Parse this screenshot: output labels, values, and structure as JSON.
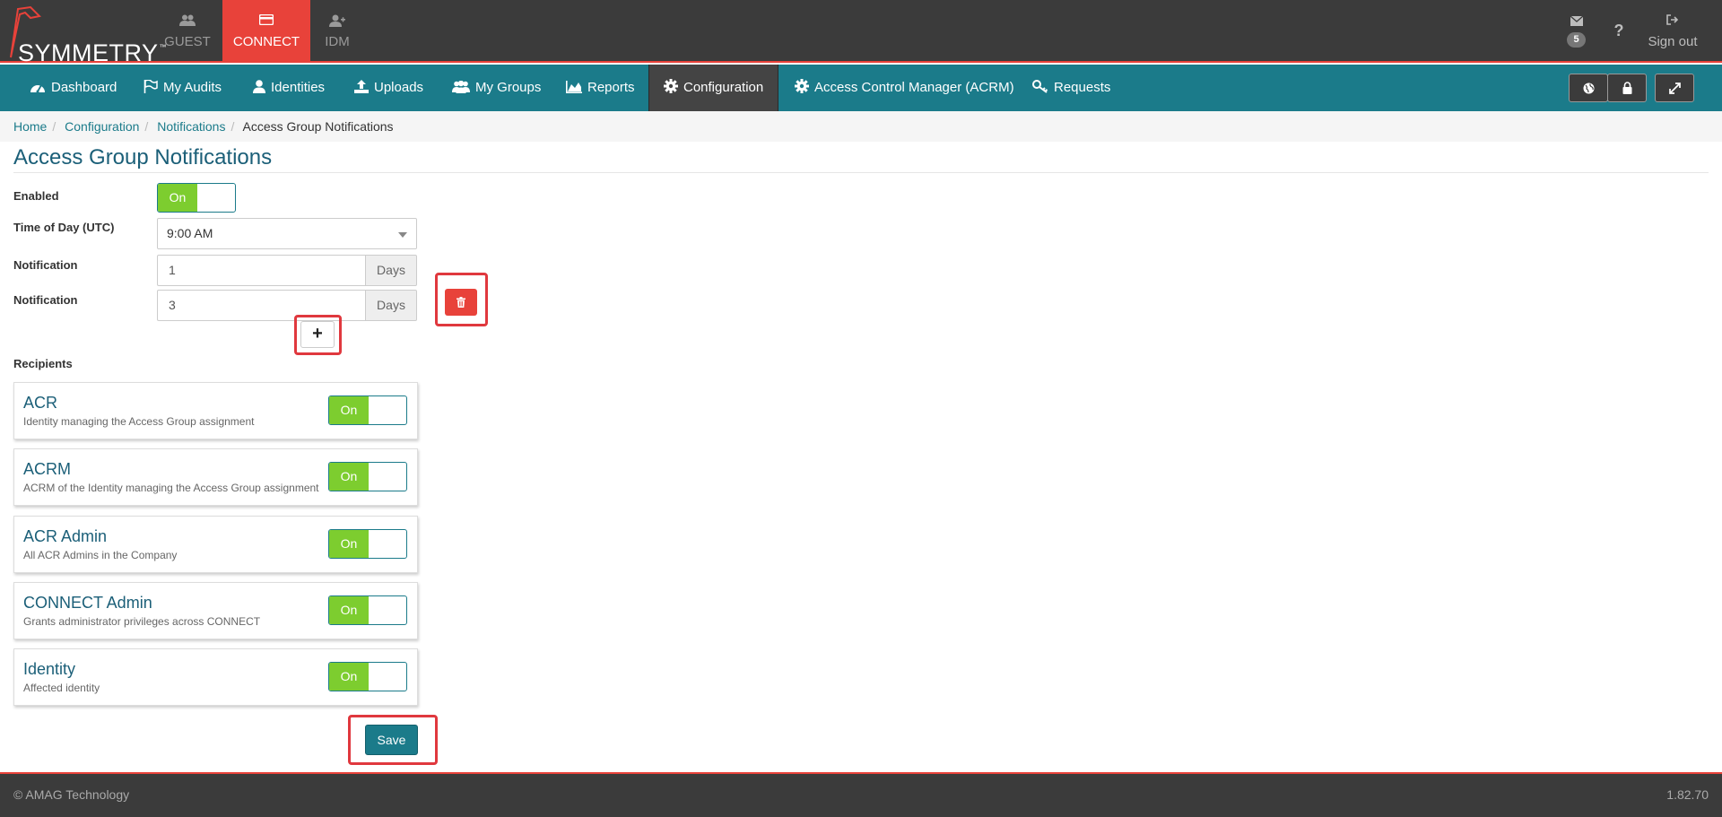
{
  "brand": {
    "logo_text": "SYMMETRY",
    "trademark": "™"
  },
  "app_tabs": [
    {
      "label": "GUEST",
      "icon": "users-icon"
    },
    {
      "label": "CONNECT",
      "icon": "card-icon",
      "active": true
    },
    {
      "label": "IDM",
      "icon": "user-plus-icon"
    }
  ],
  "top_right": {
    "mail_count": "5",
    "help": "?",
    "signout_label": "Sign out"
  },
  "nav": [
    {
      "label": "Dashboard",
      "icon": "dashboard-icon"
    },
    {
      "label": "My Audits",
      "icon": "flag-icon"
    },
    {
      "label": "Identities",
      "icon": "user-icon"
    },
    {
      "label": "Uploads",
      "icon": "upload-icon"
    },
    {
      "label": "My Groups",
      "icon": "group-icon"
    },
    {
      "label": "Reports",
      "icon": "area-chart-icon"
    },
    {
      "label": "Configuration",
      "icon": "gear-icon",
      "active": true
    },
    {
      "label": "Access Control Manager (ACRM)",
      "icon": "gear-icon"
    },
    {
      "label": "Requests",
      "icon": "key-icon"
    }
  ],
  "breadcrumb": [
    "Home",
    "Configuration",
    "Notifications",
    "Access Group Notifications"
  ],
  "page_title": "Access Group Notifications",
  "form": {
    "enabled_label": "Enabled",
    "enabled_state": "On",
    "time_label": "Time of Day (UTC)",
    "time_value": "9:00 AM",
    "notifications": [
      {
        "label": "Notification",
        "value": "1",
        "unit": "Days"
      },
      {
        "label": "Notification",
        "value": "3",
        "unit": "Days"
      }
    ],
    "add_label": "+",
    "recipients_label": "Recipients"
  },
  "recipients": [
    {
      "title": "ACR",
      "desc": "Identity managing the Access Group assignment",
      "state": "On"
    },
    {
      "title": "ACRM",
      "desc": "ACRM of the Identity managing the Access Group assignment",
      "state": "On"
    },
    {
      "title": "ACR Admin",
      "desc": "All ACR Admins in the Company",
      "state": "On"
    },
    {
      "title": "CONNECT Admin",
      "desc": "Grants administrator privileges across CONNECT",
      "state": "On"
    },
    {
      "title": "Identity",
      "desc": "Affected identity",
      "state": "On"
    }
  ],
  "save_label": "Save",
  "footer": {
    "copyright": "© AMAG Technology",
    "version": "1.82.70"
  },
  "colors": {
    "accent": "#1b7b8a",
    "brand_red": "#e8423a",
    "toggle_on": "#7dcd2f",
    "highlight": "#e0383e"
  }
}
